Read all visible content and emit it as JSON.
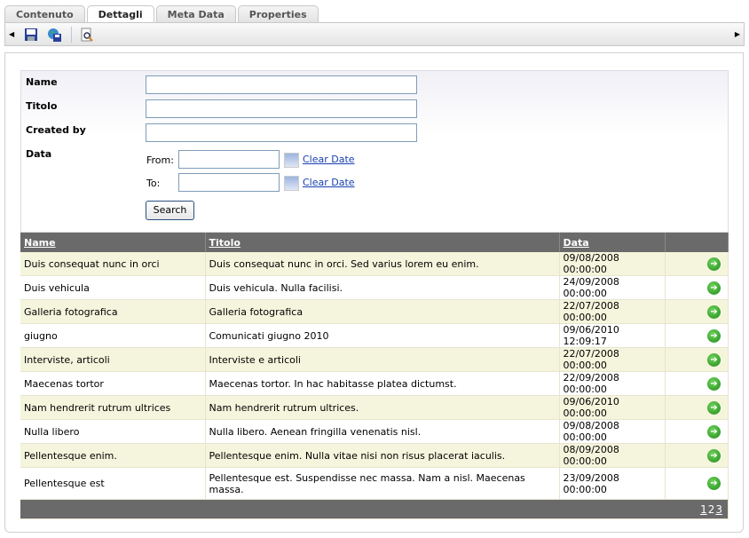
{
  "tabs": [
    {
      "label": "Contenuto"
    },
    {
      "label": "Dettagli",
      "active": true
    },
    {
      "label": "Meta Data"
    },
    {
      "label": "Properties"
    }
  ],
  "toolbar": {
    "icons": [
      "save-icon",
      "save-web-icon",
      "preview-icon"
    ]
  },
  "form": {
    "name_label": "Name",
    "titolo_label": "Titolo",
    "created_label": "Created by",
    "data_label": "Data",
    "name_value": "",
    "titolo_value": "",
    "created_value": "",
    "from_label": "From:",
    "to_label": "To:",
    "from_value": "",
    "to_value": "",
    "clear_date": "Clear Date",
    "search": "Search"
  },
  "table": {
    "headers": [
      "Name",
      "Titolo",
      "Data",
      ""
    ],
    "rows": [
      {
        "name": "Duis consequat nunc in orci",
        "titolo": "Duis consequat nunc in orci. Sed varius lorem eu enim.",
        "data": "09/08/2008 00:00:00"
      },
      {
        "name": "Duis vehicula",
        "titolo": "Duis vehicula. Nulla facilisi.",
        "data": "24/09/2008 00:00:00"
      },
      {
        "name": "Galleria fotografica",
        "titolo": "Galleria fotografica",
        "data": "22/07/2008 00:00:00"
      },
      {
        "name": "giugno",
        "titolo": "Comunicati giugno 2010",
        "data": "09/06/2010 12:09:17"
      },
      {
        "name": "Interviste, articoli",
        "titolo": "Interviste e articoli",
        "data": "22/07/2008 00:00:00"
      },
      {
        "name": "Maecenas tortor",
        "titolo": "Maecenas tortor. In hac habitasse platea dictumst.",
        "data": "22/09/2008 00:00:00"
      },
      {
        "name": "Nam hendrerit rutrum ultrices",
        "titolo": "Nam hendrerit rutrum ultrices.",
        "data": "09/06/2010 00:00:00"
      },
      {
        "name": "Nulla libero",
        "titolo": "Nulla libero. Aenean fringilla venenatis nisl.",
        "data": "09/08/2008 00:00:00"
      },
      {
        "name": "Pellentesque enim.",
        "titolo": "Pellentesque enim. Nulla vitae nisi non risus placerat iaculis.",
        "data": "08/09/2008 00:00:00"
      },
      {
        "name": "Pellentesque est",
        "titolo": "Pellentesque est. Suspendisse nec massa. Nam a nisl. Maecenas massa.",
        "data": "23/09/2008 00:00:00"
      }
    ],
    "pages": [
      "1",
      "2",
      "3"
    ],
    "current_page": "2"
  }
}
